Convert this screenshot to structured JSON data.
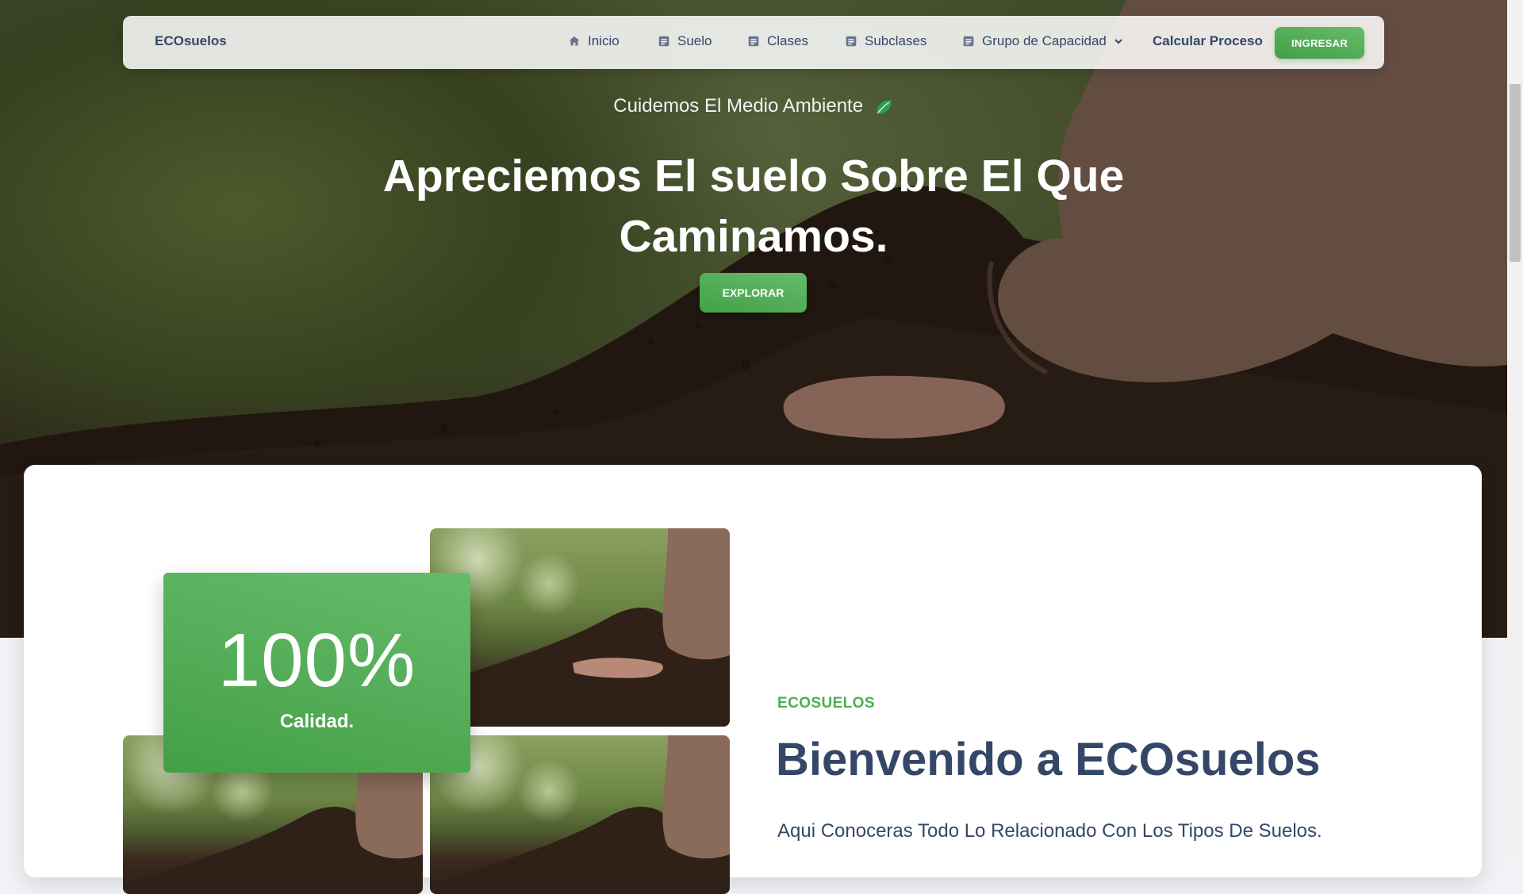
{
  "navbar": {
    "brand": "ECOsuelos",
    "items": [
      {
        "label": "Inicio",
        "icon": "home-icon"
      },
      {
        "label": "Suelo",
        "icon": "document-icon"
      },
      {
        "label": "Clases",
        "icon": "document-icon"
      },
      {
        "label": "Subclases",
        "icon": "document-icon"
      },
      {
        "label": "Grupo de Capacidad",
        "icon": "document-icon",
        "dropdown": true
      }
    ],
    "calc_label": "Calcular Proceso",
    "login_label": "INGRESAR"
  },
  "hero": {
    "tagline": "Cuidemos El Medio Ambiente",
    "title": "Apreciemos El suelo Sobre El Que Caminamos.",
    "explore_label": "EXPLORAR"
  },
  "about": {
    "stat_value": "100%",
    "stat_label": "Calidad.",
    "eyebrow": "ECOSUELOS",
    "heading": "Bienvenido a ECOsuelos",
    "subtitle": "Aqui Conoceras Todo Lo Relacionado Con Los Tipos De Suelos."
  },
  "colors": {
    "accent_green": "#4caf50",
    "text_dark": "#344767"
  }
}
